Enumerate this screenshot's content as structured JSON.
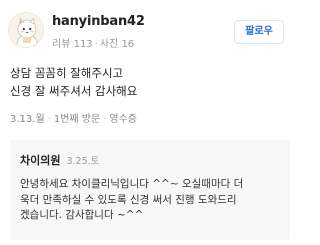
{
  "user": {
    "name": "hanyinban42",
    "reviews_label": "리뷰 113",
    "photos_label": "사진 16",
    "separator": "·",
    "avatar_icon": "cartoon-cat-avatar-icon"
  },
  "follow_button": {
    "label": "팔로우",
    "color": "#2f6fd6"
  },
  "review": {
    "lines": [
      "상담 꼼꼼히 잘해주시고",
      "신경 잘 써주셔서 감사해요"
    ]
  },
  "meta": {
    "date": "3.13.월",
    "visit": "1번째 방문",
    "receipt": "영수증",
    "dot": "·"
  },
  "reply": {
    "author": "차이의원",
    "date": "3.25.토",
    "lines": [
      "안녕하세요 차이클리닉입니다 ^^~ 오실때마다 더",
      "욱더 만족하실 수 있도록 신경 써서 진행 도와드리",
      "겠습니다. 감사합니다 ~^^"
    ]
  }
}
